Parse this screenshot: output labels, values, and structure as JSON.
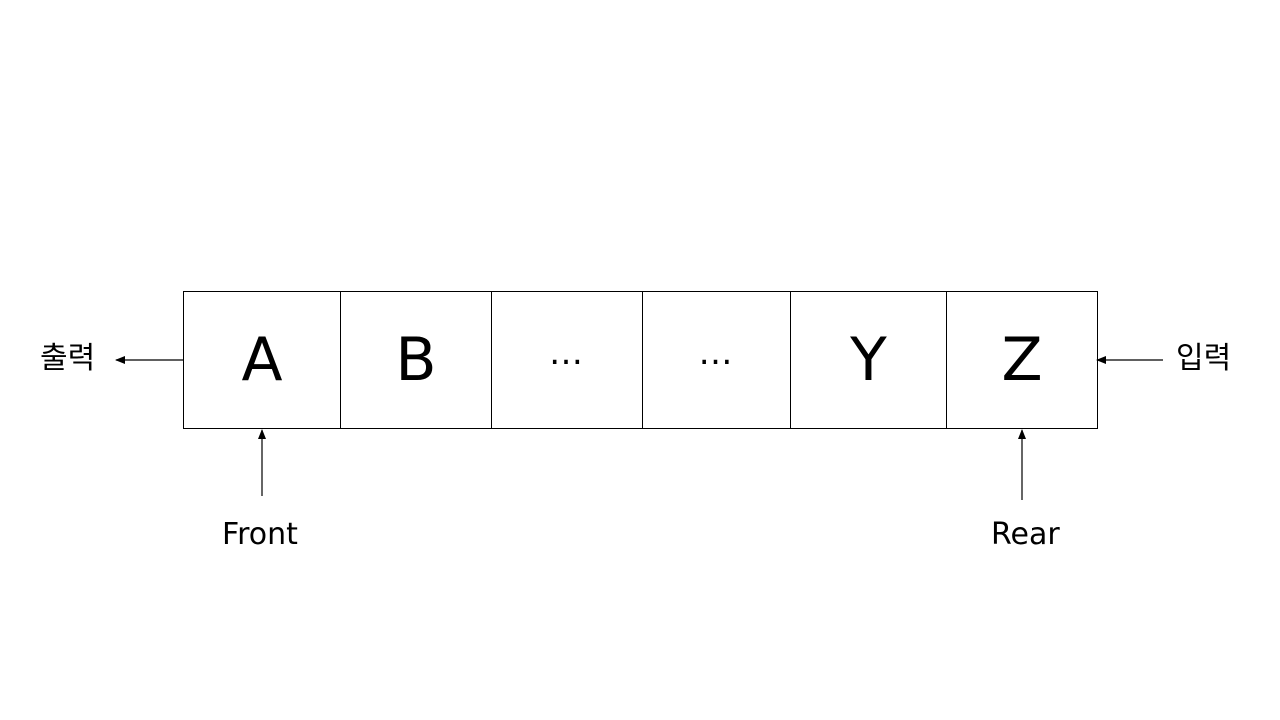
{
  "queue": {
    "cells": [
      "A",
      "B",
      "…",
      "…",
      "Y",
      "Z"
    ]
  },
  "labels": {
    "output": "출력",
    "input": "입력",
    "front": "Front",
    "rear": "Rear"
  }
}
